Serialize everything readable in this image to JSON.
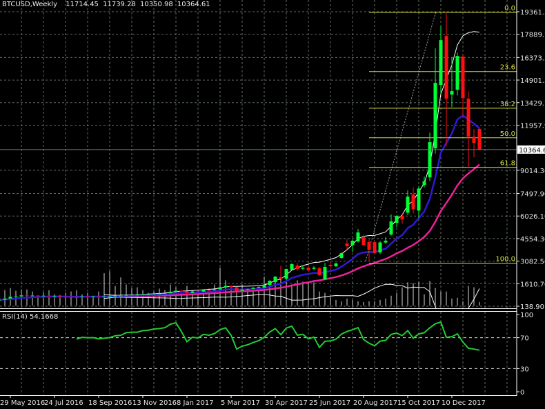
{
  "header": {
    "symbol": "BTCUSD,Weekly",
    "open": "11714.45",
    "high": "11739.28",
    "low": "10350.98",
    "close": "10364.61"
  },
  "colors": {
    "background": "#000000",
    "grid": "#5f6f60",
    "bull": "#00ff33",
    "bear": "#ff1010",
    "ema": "#3018d8",
    "sma": "#f0209a",
    "bands": "#ffffff",
    "fib": "#d8e040",
    "rsi": "#22cc33"
  },
  "chart_data": [
    {
      "type": "candlestick",
      "title": "BTCUSD,Weekly",
      "price_axis": {
        "ticks": [
          "19361.50",
          "17889.70",
          "16373.30",
          "14901.50",
          "13429.70",
          "11957.90",
          "9014.30",
          "7497.90",
          "6026.10",
          "4554.30",
          "3082.50",
          "1610.70",
          "138.90"
        ],
        "range": [
          138.9,
          19361.5
        ]
      },
      "current_price": "10364.61",
      "date_labels": [
        {
          "index": 2,
          "label": "29 May 2016"
        },
        {
          "index": 10,
          "label": "24 Jul 2016"
        },
        {
          "index": 18,
          "label": "18 Sep 2016"
        },
        {
          "index": 26,
          "label": "13 Nov 2016"
        },
        {
          "index": 34,
          "label": "8 Jan 2017"
        },
        {
          "index": 42,
          "label": "5 Mar 2017"
        },
        {
          "index": 50,
          "label": "30 Apr 2017"
        },
        {
          "index": 58,
          "label": "25 Jun 2017"
        },
        {
          "index": 66,
          "label": "20 Aug 2017"
        },
        {
          "index": 74,
          "label": "15 Oct 2017"
        },
        {
          "index": 82,
          "label": "10 Dec 2017"
        }
      ],
      "ohlc": [
        [
          520,
          580,
          505,
          560
        ],
        [
          560,
          660,
          550,
          640
        ],
        [
          640,
          790,
          630,
          760
        ],
        [
          760,
          810,
          740,
          780
        ],
        [
          780,
          900,
          770,
          850
        ],
        [
          850,
          880,
          790,
          820
        ],
        [
          820,
          860,
          800,
          840
        ],
        [
          840,
          850,
          780,
          800
        ],
        [
          800,
          850,
          790,
          830
        ],
        [
          830,
          845,
          800,
          820
        ],
        [
          820,
          840,
          800,
          820
        ],
        [
          820,
          825,
          700,
          760
        ],
        [
          760,
          780,
          730,
          750
        ],
        [
          750,
          770,
          730,
          745
        ],
        [
          745,
          760,
          725,
          740
        ],
        [
          740,
          790,
          735,
          780
        ],
        [
          780,
          795,
          765,
          775
        ],
        [
          775,
          790,
          765,
          780
        ],
        [
          780,
          790,
          760,
          770
        ],
        [
          770,
          795,
          765,
          780
        ],
        [
          780,
          800,
          775,
          790
        ],
        [
          790,
          830,
          785,
          820
        ],
        [
          820,
          845,
          810,
          830
        ],
        [
          830,
          890,
          825,
          880
        ],
        [
          880,
          900,
          860,
          890
        ],
        [
          890,
          920,
          870,
          890
        ],
        [
          890,
          935,
          880,
          920
        ],
        [
          920,
          945,
          905,
          930
        ],
        [
          930,
          960,
          920,
          955
        ],
        [
          955,
          975,
          945,
          965
        ],
        [
          965,
          990,
          955,
          985
        ],
        [
          985,
          1100,
          980,
          1090
        ],
        [
          1090,
          1250,
          1080,
          1160
        ],
        [
          1160,
          1200,
          1050,
          1100
        ],
        [
          1100,
          1110,
          900,
          1010
        ],
        [
          1010,
          1120,
          1000,
          1110
        ],
        [
          1110,
          1140,
          1080,
          1100
        ],
        [
          1100,
          1210,
          1090,
          1200
        ],
        [
          1200,
          1220,
          1160,
          1190
        ],
        [
          1190,
          1260,
          1180,
          1240
        ],
        [
          1240,
          1390,
          1230,
          1380
        ],
        [
          1380,
          1500,
          1370,
          1470
        ],
        [
          1470,
          1500,
          1350,
          1380
        ],
        [
          1380,
          1400,
          1100,
          1150
        ],
        [
          1150,
          1250,
          1140,
          1230
        ],
        [
          1230,
          1290,
          1210,
          1270
        ],
        [
          1270,
          1360,
          1260,
          1340
        ],
        [
          1340,
          1430,
          1320,
          1400
        ],
        [
          1354,
          1560,
          1340,
          1534
        ],
        [
          1534,
          1830,
          1520,
          1804
        ],
        [
          1714,
          2100,
          1700,
          2074
        ],
        [
          2029,
          2794,
          1900,
          1939
        ],
        [
          1939,
          2600,
          1900,
          2569
        ],
        [
          2524,
          2950,
          2500,
          2884
        ],
        [
          2794,
          2974,
          2450,
          2569
        ],
        [
          2590,
          2820,
          2500,
          2660
        ],
        [
          2659,
          2750,
          2400,
          2479
        ],
        [
          2580,
          2750,
          2500,
          2650
        ],
        [
          2614,
          2700,
          2119,
          2164
        ],
        [
          1894,
          2974,
          1850,
          2704
        ],
        [
          2840,
          3000,
          2600,
          2750
        ],
        [
          2749,
          3000,
          2700,
          2929
        ],
        [
          3289,
          3650,
          3250,
          3604
        ],
        [
          4234,
          4517,
          3842,
          4054
        ],
        [
          4144,
          4500,
          3694,
          4414
        ],
        [
          4369,
          5180,
          4300,
          4954
        ],
        [
          4639,
          4819,
          4100,
          4144
        ],
        [
          4324,
          4500,
          3109,
          3829
        ],
        [
          4324,
          4400,
          3550,
          3604
        ],
        [
          3650,
          4400,
          3550,
          4300
        ],
        [
          4300,
          4650,
          4200,
          4420
        ],
        [
          4819,
          6130,
          4750,
          5674
        ],
        [
          5584,
          6100,
          5300,
          6034
        ],
        [
          6034,
          6200,
          5500,
          5809
        ],
        [
          6245,
          7700,
          6100,
          7294
        ],
        [
          7443,
          7893,
          6200,
          6470
        ],
        [
          6380,
          8000,
          5900,
          7820
        ],
        [
          8060,
          8600,
          7900,
          8284
        ],
        [
          8554,
          11479,
          8300,
          10849
        ],
        [
          10444,
          16969,
          10100,
          14719
        ],
        [
          14584,
          18409,
          14000,
          17509
        ],
        [
          17779,
          19264,
          10579,
          13684
        ],
        [
          13954,
          16384,
          13144,
          14179
        ],
        [
          14269,
          16700,
          13900,
          16474
        ],
        [
          16429,
          16500,
          12604,
          13729
        ],
        [
          13684,
          14179,
          9184,
          11209
        ],
        [
          11209,
          11704,
          9859,
          10804
        ],
        [
          11714.45,
          11739.28,
          10350.98,
          10364.61
        ]
      ],
      "volume": [
        17,
        22,
        25,
        21,
        23,
        23,
        20,
        13,
        19,
        22,
        16,
        15,
        18,
        20,
        22,
        16,
        18,
        14,
        20,
        46,
        49,
        28,
        40,
        30,
        25,
        26,
        22,
        18,
        20,
        24,
        22,
        30,
        26,
        22,
        28,
        22,
        20,
        18,
        24,
        30,
        54,
        36,
        28,
        25,
        30,
        20,
        26,
        22,
        41,
        33,
        36,
        38,
        42,
        30,
        36,
        34,
        33,
        33,
        20,
        18,
        12,
        8,
        6,
        10,
        8,
        6,
        5,
        6,
        6,
        8,
        10,
        14,
        18,
        26,
        33,
        32,
        34,
        16,
        35,
        25,
        20,
        20,
        10,
        11,
        6,
        28,
        26,
        5
      ],
      "indicators": {
        "ema_period": 10,
        "sma_period": 21,
        "bollinger": {
          "period": 20,
          "deviation": 2
        }
      },
      "fibonacci": {
        "high": 19322,
        "low": 2942,
        "levels": [
          "0.0",
          "23.6",
          "38.2",
          "50.0",
          "61.8",
          "100.0"
        ]
      },
      "trendline": {
        "from": [
          66.4,
          3100
        ],
        "to": [
          79.1,
          19360
        ]
      }
    },
    {
      "type": "line",
      "title": "RSI(14) 54.1668",
      "label": "RSI(14)",
      "value": "54.1668",
      "period": 14,
      "axis_ticks": [
        "100",
        "70",
        "30",
        "0"
      ],
      "ylim": [
        0,
        100
      ],
      "levels": [
        70,
        30
      ]
    }
  ]
}
